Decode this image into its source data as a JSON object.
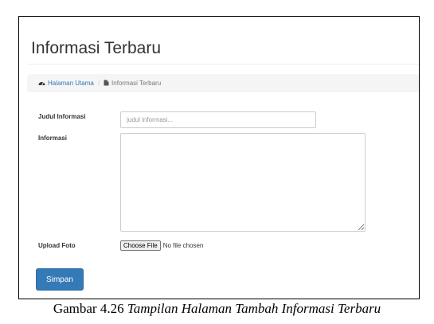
{
  "page": {
    "title": "Informasi Terbaru"
  },
  "breadcrumb": {
    "home_label": "Halaman Utama",
    "home_icon": "dashboard-icon",
    "current_label": "Informasi Terbaru",
    "current_icon": "file-icon"
  },
  "form": {
    "judul_label": "Judul Informasi",
    "judul_placeholder": "judul informasi...",
    "judul_value": "",
    "informasi_label": "Informasi",
    "informasi_value": "",
    "foto_label": "Upload Foto",
    "choose_file_label": "Choose File",
    "file_status": "No file chosen",
    "submit_label": "Simpan"
  },
  "caption": {
    "number": "Gambar 4.26",
    "title": "Tampilan Halaman Tambah Informasi Terbaru"
  },
  "colors": {
    "primary": "#337ab7",
    "breadcrumb_bg": "#f5f5f5",
    "link": "#337ab7"
  }
}
